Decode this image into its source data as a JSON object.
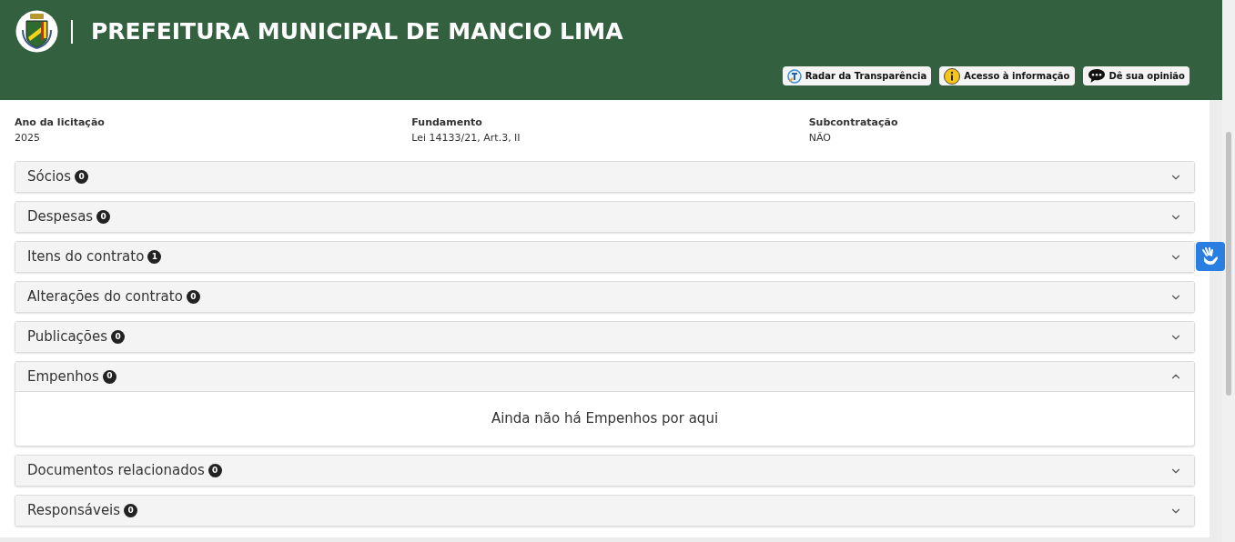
{
  "header": {
    "title": "PREFEITURA MUNICIPAL DE MANCIO LIMA",
    "links": [
      {
        "kind": "radar",
        "label": "Radar da Transparência"
      },
      {
        "kind": "info",
        "label": "Acesso à informação"
      },
      {
        "kind": "chat",
        "label": "Dê sua opinião"
      }
    ]
  },
  "fields": [
    {
      "label": "Ano da licitação",
      "value": "2025"
    },
    {
      "label": "Fundamento",
      "value": "Lei 14133/21, Art.3, II"
    },
    {
      "label": "Subcontratação",
      "value": "NÃO"
    }
  ],
  "sections": [
    {
      "title": "Sócios",
      "count": "0",
      "expanded": false
    },
    {
      "title": "Despesas",
      "count": "0",
      "expanded": false
    },
    {
      "title": "Itens do contrato",
      "count": "1",
      "expanded": false
    },
    {
      "title": "Alterações do contrato",
      "count": "0",
      "expanded": false
    },
    {
      "title": "Publicações",
      "count": "0",
      "expanded": false
    },
    {
      "title": "Empenhos",
      "count": "0",
      "expanded": true,
      "empty_message": "Ainda não há Empenhos por aqui"
    },
    {
      "title": "Documentos relacionados",
      "count": "0",
      "expanded": false
    },
    {
      "title": "Responsáveis",
      "count": "0",
      "expanded": false
    }
  ]
}
